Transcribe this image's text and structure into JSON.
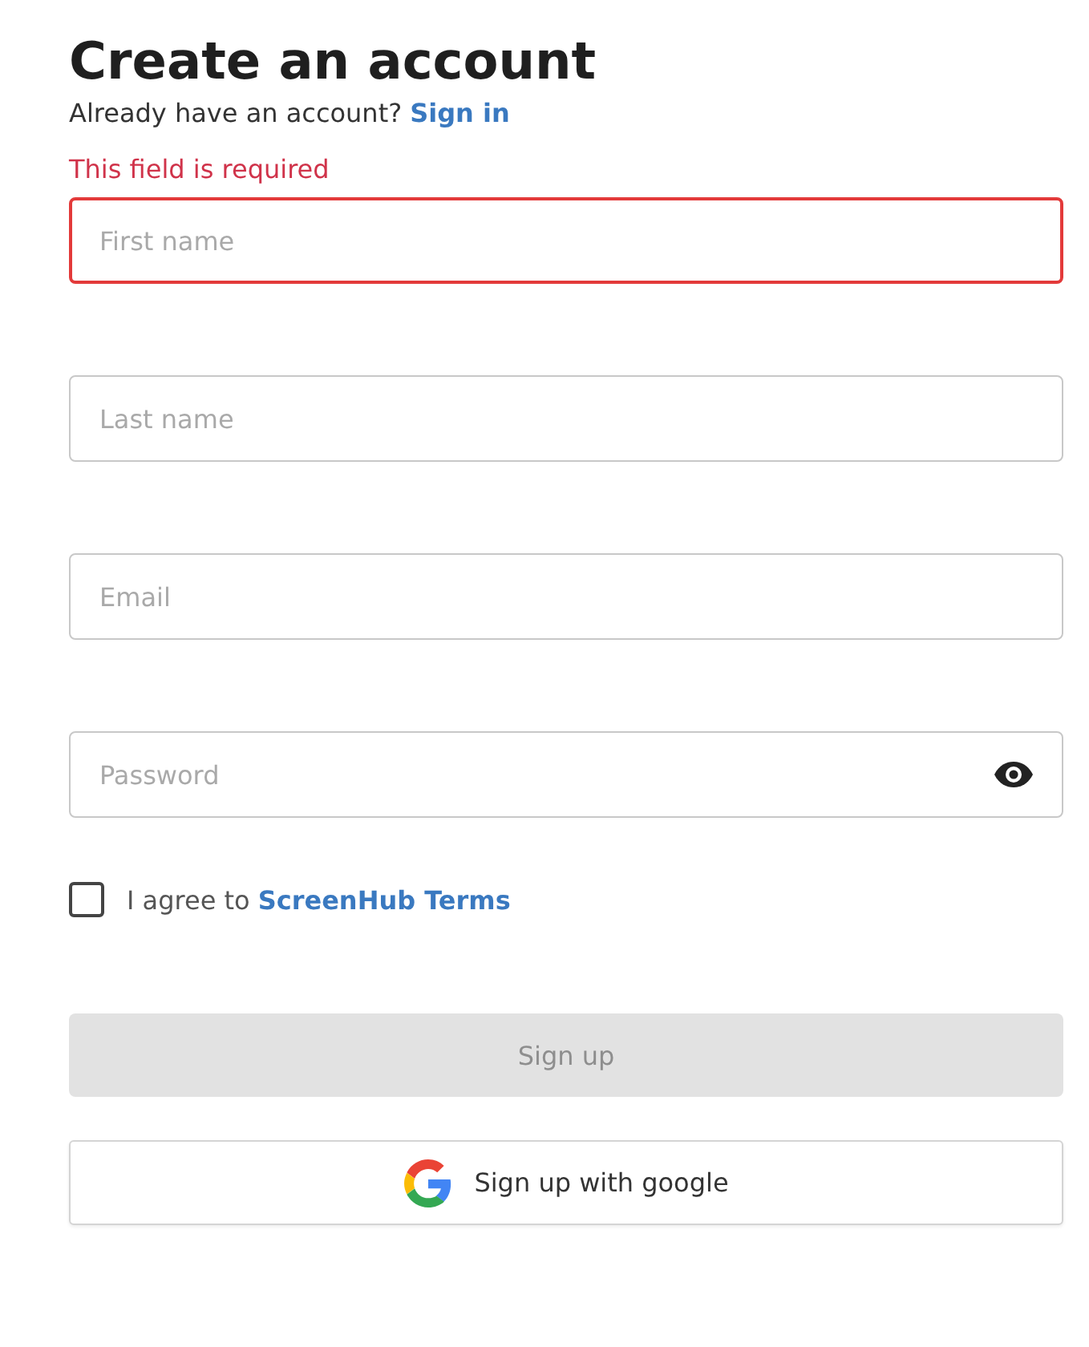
{
  "title": "Create an account",
  "signin_prompt": {
    "text": "Already have an account?",
    "link": "Sign in"
  },
  "fields": [
    {
      "kind": "text",
      "placeholder": "First name",
      "error": "This field is required"
    },
    {
      "kind": "text",
      "placeholder": "Last name"
    },
    {
      "kind": "email",
      "placeholder": "Email"
    },
    {
      "kind": "password",
      "placeholder": "Password"
    }
  ],
  "terms": {
    "checked": false,
    "text": "I agree to",
    "link": "ScreenHub Terms"
  },
  "signup_button": {
    "label": "Sign up",
    "disabled": true
  },
  "google_button": {
    "label": "Sign up with google"
  }
}
